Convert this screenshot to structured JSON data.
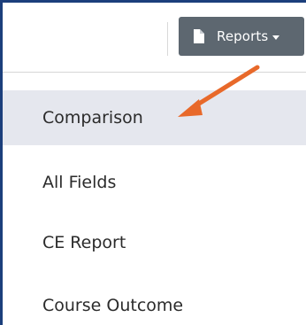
{
  "toolbar": {
    "reports_label": "Reports",
    "reports_icon": "document-icon",
    "button_color": "#5d6770"
  },
  "menu": {
    "items": [
      {
        "label": "Comparison",
        "highlighted": true
      },
      {
        "label": "All Fields",
        "highlighted": false
      },
      {
        "label": "CE Report",
        "highlighted": false
      },
      {
        "label": "Course Outcome",
        "highlighted": false
      }
    ]
  },
  "annotation": {
    "arrow_color": "#e8692a",
    "points_to": "Comparison"
  },
  "colors": {
    "frame": "#1c3f7c",
    "highlight": "#e5e7ee"
  }
}
